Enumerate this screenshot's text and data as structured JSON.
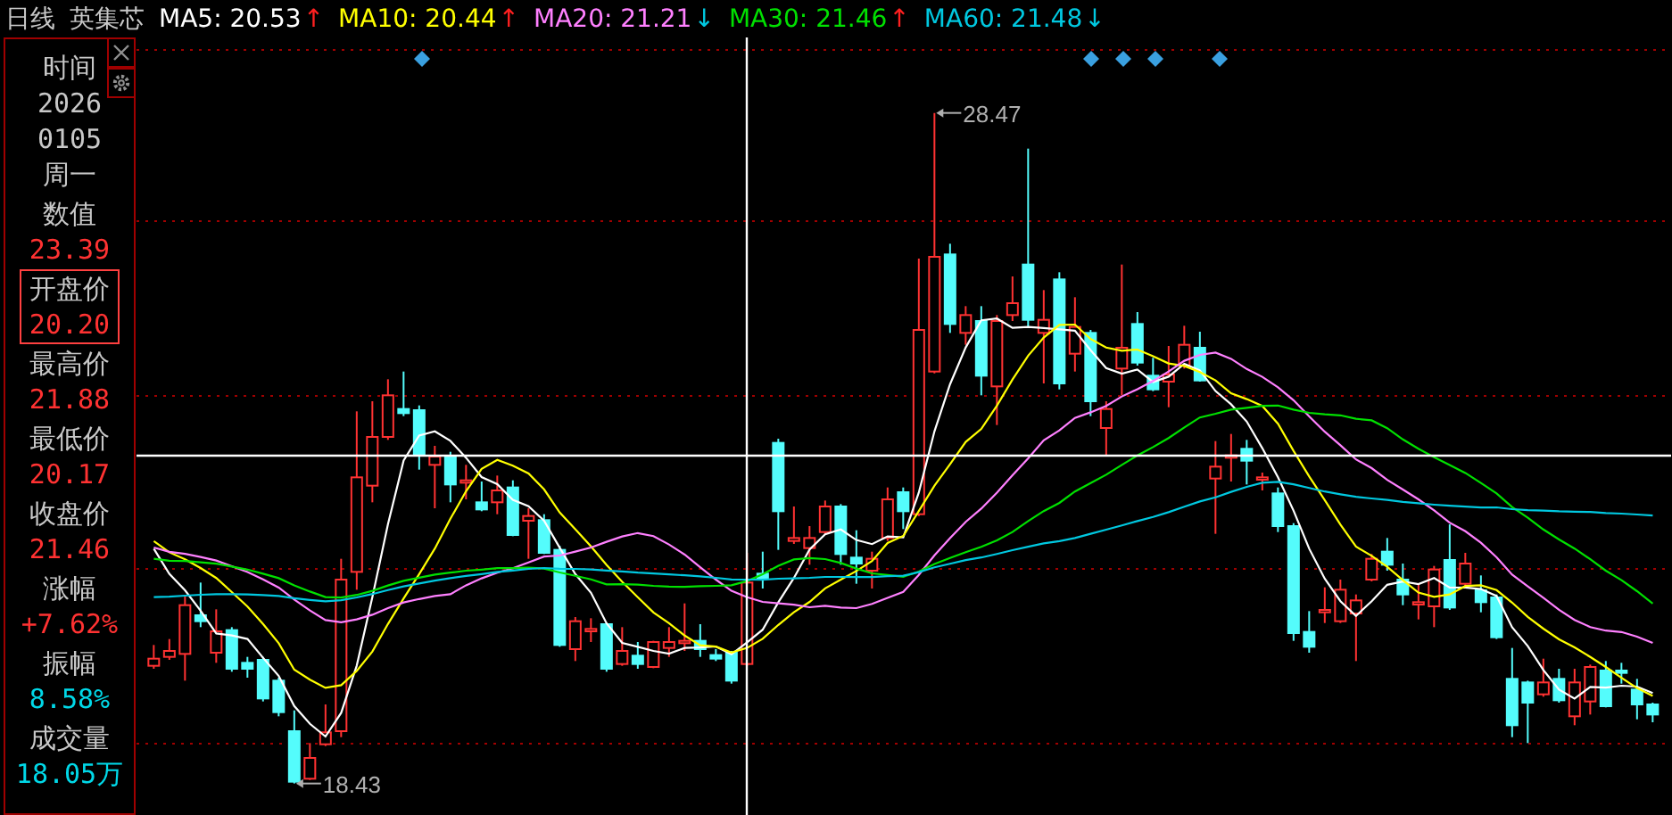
{
  "header": {
    "period": "日线",
    "stock_name": "英集芯"
  },
  "ma_indicators": [
    {
      "text": "MA5: 20.53",
      "arrow": "↑",
      "rising": true,
      "color": "#ffffff"
    },
    {
      "text": "MA10: 20.44",
      "arrow": "↑",
      "rising": true,
      "color": "#ffff00"
    },
    {
      "text": "MA20: 21.21",
      "arrow": "↓",
      "rising": false,
      "color": "#ff80ff"
    },
    {
      "text": "MA30: 21.46",
      "arrow": "↑",
      "rising": true,
      "color": "#00e000"
    },
    {
      "text": "MA60: 21.48",
      "arrow": "↓",
      "rising": false,
      "color": "#00c8e0"
    }
  ],
  "info_panel": [
    {
      "label": "时间",
      "values": [
        {
          "text": "2026",
          "color": "#c8c8c8"
        },
        {
          "text": "0105",
          "color": "#c8c8c8"
        },
        {
          "text": "周一",
          "color": "#c8c8c8"
        }
      ],
      "selected": false
    },
    {
      "label": "数值",
      "values": [
        {
          "text": "23.39",
          "color": "#ff3232"
        }
      ],
      "selected": false
    },
    {
      "label": "开盘价",
      "values": [
        {
          "text": "20.20",
          "color": "#ff3232"
        }
      ],
      "selected": true
    },
    {
      "label": "最高价",
      "values": [
        {
          "text": "21.88",
          "color": "#ff3232"
        }
      ],
      "selected": false
    },
    {
      "label": "最低价",
      "values": [
        {
          "text": "20.17",
          "color": "#ff3232"
        }
      ],
      "selected": false
    },
    {
      "label": "收盘价",
      "values": [
        {
          "text": "21.46",
          "color": "#ff3232"
        }
      ],
      "selected": false
    },
    {
      "label": "涨幅",
      "values": [
        {
          "text": "+7.62%",
          "color": "#ff3232"
        }
      ],
      "selected": false
    },
    {
      "label": "振幅",
      "values": [
        {
          "text": "8.58%",
          "color": "#00d8e8"
        }
      ],
      "selected": false
    },
    {
      "label": "成交量",
      "values": [
        {
          "text": "18.05万",
          "color": "#00d8e8"
        }
      ],
      "selected": false
    }
  ],
  "chart_labels": [
    {
      "text": "28.47",
      "kind": "high"
    },
    {
      "text": "18.43",
      "kind": "low"
    }
  ]
}
